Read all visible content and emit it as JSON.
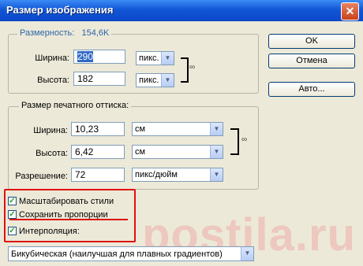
{
  "window": {
    "title": "Размер изображения",
    "close_glyph": "✕"
  },
  "pixel_dims": {
    "label": "Размерность:",
    "size": "154,6K",
    "width_label": "Ширина:",
    "width_value": "290",
    "width_unit": "пикс.",
    "height_label": "Высота:",
    "height_value": "182",
    "height_unit": "пикс."
  },
  "doc_size": {
    "label": "Размер печатного оттиска:",
    "width_label": "Ширина:",
    "width_value": "10,23",
    "width_unit": "см",
    "height_label": "Высота:",
    "height_value": "6,42",
    "height_unit": "см",
    "resolution_label": "Разрешение:",
    "resolution_value": "72",
    "resolution_unit": "пикс/дюйм"
  },
  "buttons": {
    "ok": "OK",
    "cancel": "Отмена",
    "auto": "Авто..."
  },
  "options": {
    "scale_styles": "Масштабировать стили",
    "constrain": "Сохранить пропорции",
    "resample": "Интерполяция:",
    "resample_method": "Бикубическая (наилучшая для плавных градиентов)"
  },
  "watermark": "postila.ru",
  "icons": {
    "link": "chain-link-icon",
    "check": "checkmark-icon",
    "dropdown": "chevron-down-icon"
  }
}
